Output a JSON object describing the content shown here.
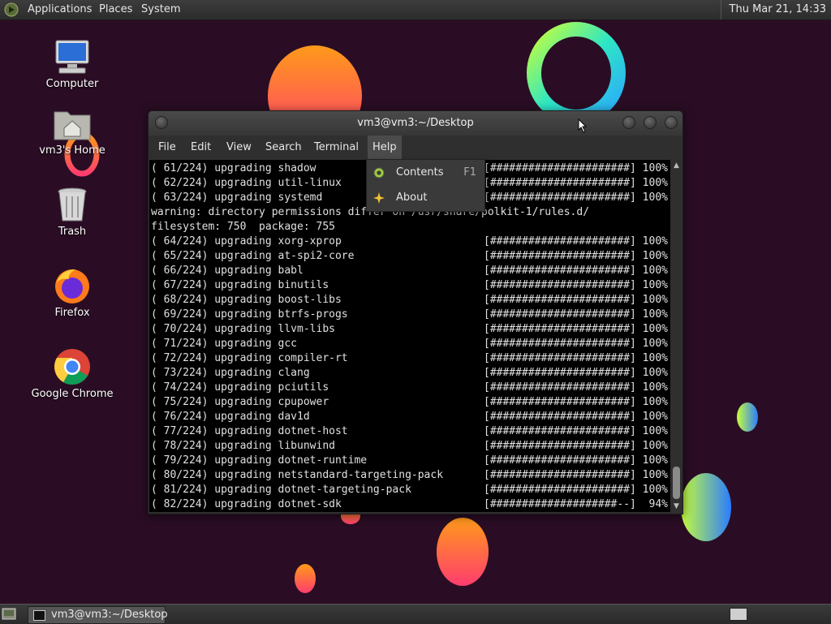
{
  "top_panel": {
    "menus": [
      "Applications",
      "Places",
      "System"
    ],
    "clock": "Thu Mar 21, 14:33",
    "logo_icon": "distro-logo-icon"
  },
  "desktop_icons": [
    {
      "label": "Computer",
      "icon": "computer-icon"
    },
    {
      "label": "vm3's Home",
      "icon": "home-folder-icon"
    },
    {
      "label": "Trash",
      "icon": "trash-icon"
    },
    {
      "label": "Firefox",
      "icon": "firefox-icon"
    },
    {
      "label": "Google Chrome",
      "icon": "chrome-icon"
    }
  ],
  "window": {
    "title": "vm3@vm3:~/Desktop",
    "menu": [
      "File",
      "Edit",
      "View",
      "Search",
      "Terminal",
      "Help"
    ],
    "active_menu": "Help"
  },
  "help_menu": {
    "items": [
      {
        "label": "Contents",
        "shortcut": "F1",
        "icon": "help-lifebuoy-icon"
      },
      {
        "label": "About",
        "shortcut": "",
        "icon": "about-star-icon"
      }
    ]
  },
  "terminal": {
    "lines": [
      {
        "text": "( 61/224) upgrading shadow",
        "bar": "[######################] 100%"
      },
      {
        "text": "( 62/224) upgrading util-linux",
        "bar": "[######################] 100%"
      },
      {
        "text": "( 63/224) upgrading systemd",
        "bar": "[######################] 100%"
      },
      {
        "text": "warning: directory permissions differ on /usr/share/polkit-1/rules.d/",
        "bar": ""
      },
      {
        "text": "filesystem: 750  package: 755",
        "bar": ""
      },
      {
        "text": "( 64/224) upgrading xorg-xprop",
        "bar": "[######################] 100%"
      },
      {
        "text": "( 65/224) upgrading at-spi2-core",
        "bar": "[######################] 100%"
      },
      {
        "text": "( 66/224) upgrading babl",
        "bar": "[######################] 100%"
      },
      {
        "text": "( 67/224) upgrading binutils",
        "bar": "[######################] 100%"
      },
      {
        "text": "( 68/224) upgrading boost-libs",
        "bar": "[######################] 100%"
      },
      {
        "text": "( 69/224) upgrading btrfs-progs",
        "bar": "[######################] 100%"
      },
      {
        "text": "( 70/224) upgrading llvm-libs",
        "bar": "[######################] 100%"
      },
      {
        "text": "( 71/224) upgrading gcc",
        "bar": "[######################] 100%"
      },
      {
        "text": "( 72/224) upgrading compiler-rt",
        "bar": "[######################] 100%"
      },
      {
        "text": "( 73/224) upgrading clang",
        "bar": "[######################] 100%"
      },
      {
        "text": "( 74/224) upgrading pciutils",
        "bar": "[######################] 100%"
      },
      {
        "text": "( 75/224) upgrading cpupower",
        "bar": "[######################] 100%"
      },
      {
        "text": "( 76/224) upgrading dav1d",
        "bar": "[######################] 100%"
      },
      {
        "text": "( 77/224) upgrading dotnet-host",
        "bar": "[######################] 100%"
      },
      {
        "text": "( 78/224) upgrading libunwind",
        "bar": "[######################] 100%"
      },
      {
        "text": "( 79/224) upgrading dotnet-runtime",
        "bar": "[######################] 100%"
      },
      {
        "text": "( 80/224) upgrading netstandard-targeting-pack",
        "bar": "[######################] 100%"
      },
      {
        "text": "( 81/224) upgrading dotnet-targeting-pack",
        "bar": "[######################] 100%"
      },
      {
        "text": "( 82/224) upgrading dotnet-sdk",
        "bar": "[####################--]  94%"
      }
    ]
  },
  "taskbar": {
    "window_button": "vm3@vm3:~/Desktop",
    "show_desktop_icon": "show-desktop-icon",
    "workspace_icon": "workspace-switcher-icon"
  },
  "colors": {
    "wallpaper": "#2a0d24",
    "panel": "#333333",
    "terminal_bg": "#000000"
  }
}
